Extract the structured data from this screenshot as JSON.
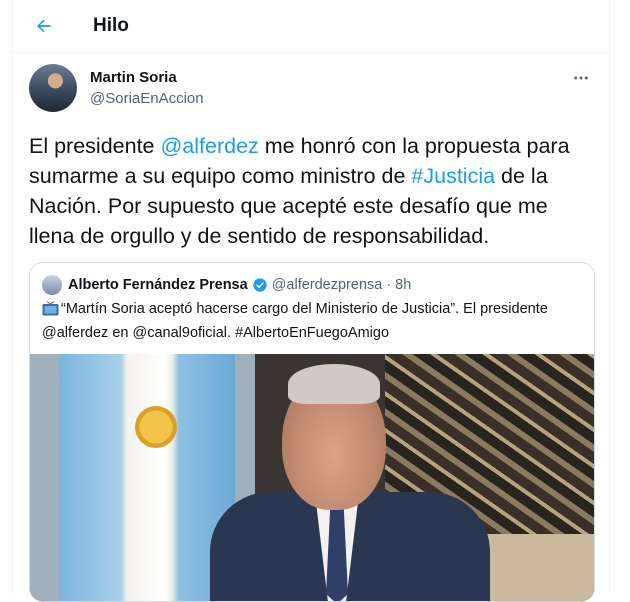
{
  "header": {
    "title": "Hilo"
  },
  "tweet": {
    "author_name": "Martin Soria",
    "author_handle": "@SoriaEnAccion",
    "text_parts": {
      "p1": "El presidente ",
      "mention": "@alferdez",
      "p2": " me honró con la propuesta para sumarme a su equipo como ministro de ",
      "hashtag": "#Justicia",
      "p3": " de la Nación. Por supuesto que acepté este desafío que me llena de orgullo y de sentido de responsabilidad."
    }
  },
  "quote": {
    "author_name": "Alberto Fernández Prensa",
    "author_handle": "@alferdezprensa",
    "separator": "·",
    "time": "8h",
    "text": "“Martín Soria aceptó hacerse cargo del Ministerio de Justicia”. El presidente @alferdez en @canal9oficial. #AlbertoEnFuegoAmigo"
  },
  "colors": {
    "accent": "#1d9bf0",
    "text": "#0f1419",
    "secondary": "#536471",
    "border": "#cfd9de"
  },
  "icons": {
    "back": "arrow-left-icon",
    "more": "more-horizontal-icon",
    "verified": "verified-badge-icon",
    "tv": "tv-emoji-icon"
  }
}
